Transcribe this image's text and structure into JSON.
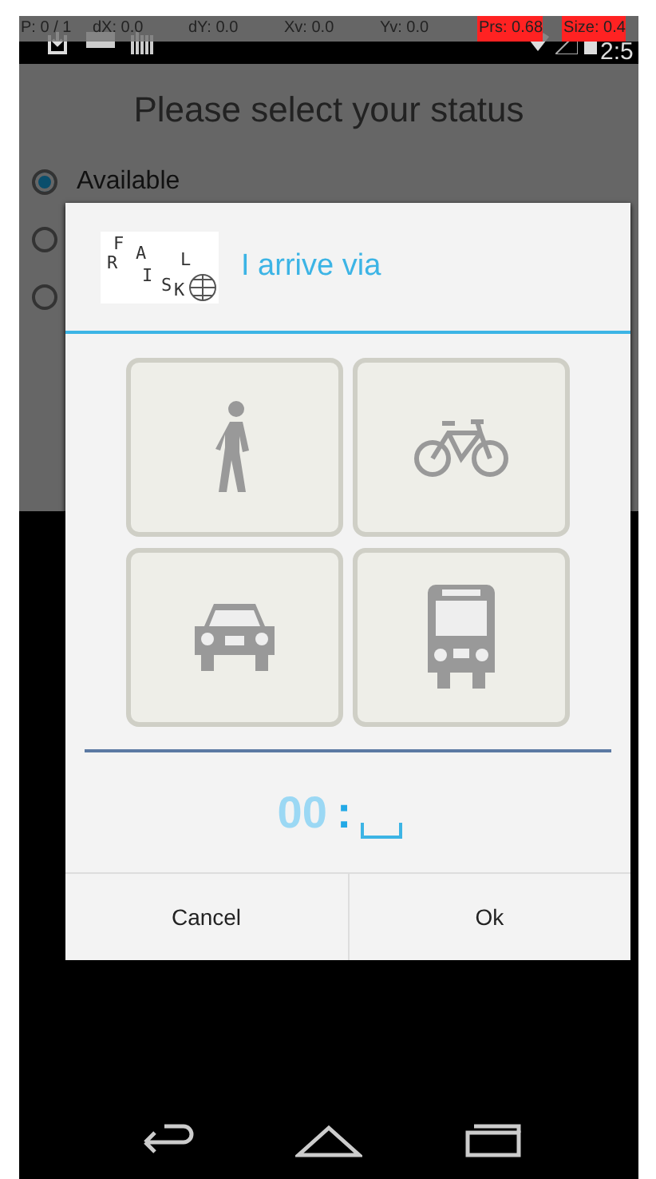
{
  "debug_bar": [
    "P: 0 / 1",
    "dX: 0.0",
    "dY: 0.0",
    "Xv: 0.0",
    "Yv: 0.0",
    "Prs: 0.68",
    "Size: 0.4"
  ],
  "status_bar": {
    "time": "2:5"
  },
  "background": {
    "title": "Please select your status",
    "radios": [
      {
        "label": "Available",
        "selected": true
      },
      {
        "selected": false
      },
      {
        "selected": false
      }
    ]
  },
  "dialog": {
    "logo_letters": [
      "F",
      "R",
      "A",
      "I",
      "S",
      "L",
      "K"
    ],
    "title": "I arrive via",
    "options": [
      {
        "kind": "walk",
        "selected": false
      },
      {
        "kind": "bicycle",
        "selected": false
      },
      {
        "kind": "car",
        "selected": false
      },
      {
        "kind": "bus",
        "selected": false
      }
    ],
    "time": {
      "hours": "00",
      "separator": ":"
    },
    "buttons": [
      "Cancel",
      "Ok"
    ]
  }
}
